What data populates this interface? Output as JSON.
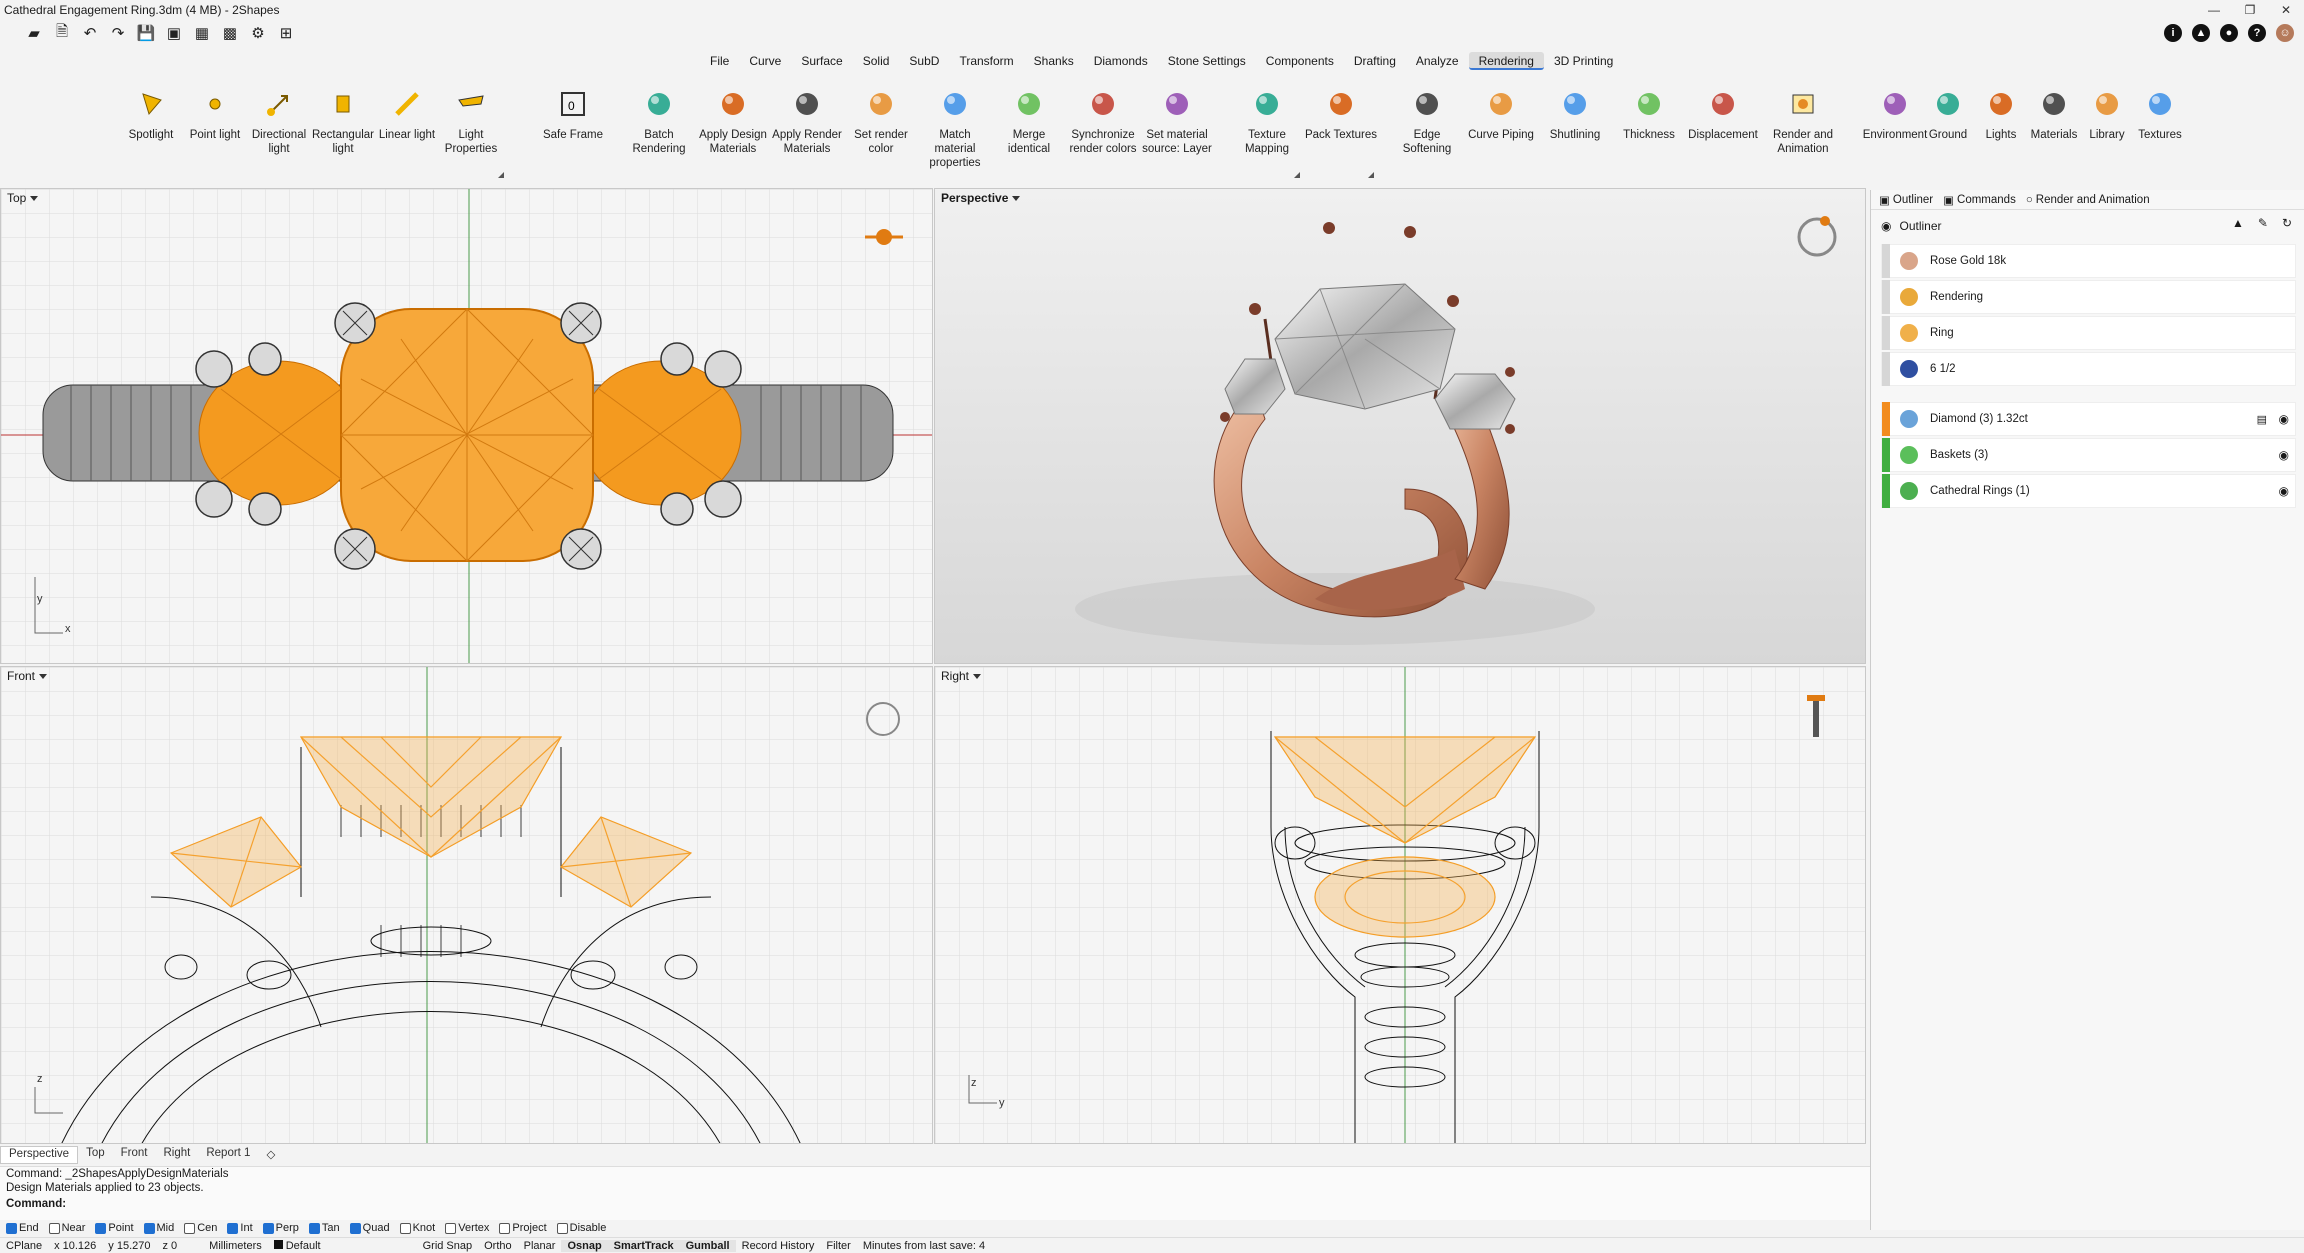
{
  "window": {
    "title": "Cathedral Engagement Ring.3dm (4 MB) - 2Shapes",
    "controls": [
      "—",
      "❐",
      "✕"
    ]
  },
  "menus": [
    "File",
    "Curve",
    "Surface",
    "Solid",
    "SubD",
    "Transform",
    "Shanks",
    "Diamonds",
    "Stone Settings",
    "Components",
    "Drafting",
    "Analyze",
    "Rendering",
    "3D Printing"
  ],
  "active_menu": "Rendering",
  "ribbon": {
    "lights": [
      {
        "label": "Spotlight"
      },
      {
        "label": "Point light"
      },
      {
        "label": "Directional\nlight"
      },
      {
        "label": "Rectangular\nlight"
      },
      {
        "label": "Linear light"
      },
      {
        "label": "Light\nProperties"
      }
    ],
    "safe_frame": "Safe Frame",
    "materials_group": [
      {
        "label": "Batch\nRendering"
      },
      {
        "label": "Apply Design\nMaterials"
      },
      {
        "label": "Apply Render\nMaterials"
      },
      {
        "label": "Set render\ncolor"
      },
      {
        "label": "Match material\nproperties"
      },
      {
        "label": "Merge\nidentical"
      },
      {
        "label": "Synchronize\nrender colors"
      },
      {
        "label": "Set material\nsource: Layer"
      }
    ],
    "texture_group": [
      {
        "label": "Texture\nMapping"
      },
      {
        "label": "Pack Textures"
      },
      {
        "label": "Edge Softening"
      },
      {
        "label": "Curve Piping"
      },
      {
        "label": "Shutlining"
      },
      {
        "label": "Thickness"
      },
      {
        "label": "Displacement"
      }
    ],
    "render_animation": "Render and\nAnimation",
    "env_group": [
      {
        "label": "Environment"
      },
      {
        "label": "Ground"
      },
      {
        "label": "Lights"
      },
      {
        "label": "Materials"
      },
      {
        "label": "Library"
      },
      {
        "label": "Textures"
      }
    ]
  },
  "viewports": {
    "top": {
      "title": "Top",
      "axis_y": "y",
      "axis_x": "x"
    },
    "perspective": {
      "title": "Perspective"
    },
    "front": {
      "title": "Front",
      "axis_z": "z"
    },
    "right": {
      "title": "Right",
      "axis_z": "z",
      "axis_y": "y"
    }
  },
  "viewport_tabs": [
    "Perspective",
    "Top",
    "Front",
    "Right",
    "Report 1"
  ],
  "command": {
    "history1": "Command: _2ShapesApplyDesignMaterials",
    "history2": "Design Materials applied to 23 objects.",
    "prompt": "Command:"
  },
  "osnaps": [
    {
      "label": "End",
      "on": true
    },
    {
      "label": "Near",
      "on": false
    },
    {
      "label": "Point",
      "on": true
    },
    {
      "label": "Mid",
      "on": true
    },
    {
      "label": "Cen",
      "on": false
    },
    {
      "label": "Int",
      "on": true
    },
    {
      "label": "Perp",
      "on": true
    },
    {
      "label": "Tan",
      "on": true
    },
    {
      "label": "Quad",
      "on": true
    },
    {
      "label": "Knot",
      "on": false
    },
    {
      "label": "Vertex",
      "on": false
    },
    {
      "label": "Project",
      "on": false
    },
    {
      "label": "Disable",
      "on": false
    }
  ],
  "status": {
    "cplane": "CPlane",
    "x": "x 10.126",
    "y": "y 15.270",
    "z": "z 0",
    "units": "Millimeters",
    "layer": "Default",
    "grid_snap": "Grid Snap",
    "ortho": "Ortho",
    "planar": "Planar",
    "osnap": "Osnap",
    "smarttrack": "SmartTrack",
    "gumball": "Gumball",
    "record_history": "Record History",
    "filter": "Filter",
    "minutes": "Minutes from last save: 4"
  },
  "panel": {
    "tabs": [
      "Outliner",
      "Commands",
      "Render and Animation"
    ],
    "header": "Outliner",
    "items_top": [
      {
        "label": "Rose Gold 18k",
        "icon": "rose-gold-material-icon",
        "color": "#d9a58a"
      },
      {
        "label": "Rendering",
        "icon": "rendering-icon",
        "color": "#e9a93a"
      },
      {
        "label": "Ring",
        "icon": "ring-icon",
        "color": "#f0b04a"
      },
      {
        "label": "6 1/2",
        "icon": "us-flag-icon",
        "color": "#2f4fa1"
      }
    ],
    "items_layers": [
      {
        "label": "Diamond (3) 1.32ct",
        "bar": "#f28c1e",
        "icon": "diamond-layer-icon",
        "color": "#6aa3d9"
      },
      {
        "label": "Baskets (3)",
        "bar": "#3fae3f",
        "icon": "basket-layer-icon",
        "color": "#5bbf5b"
      },
      {
        "label": "Cathedral Rings (1)",
        "bar": "#3fae3f",
        "icon": "ring-layer-icon",
        "color": "#4caf50"
      }
    ]
  },
  "colors": {
    "accent": "#1f6fd1",
    "gem_orange": "#f49a1f",
    "rose_gold": "#d39b7d"
  }
}
